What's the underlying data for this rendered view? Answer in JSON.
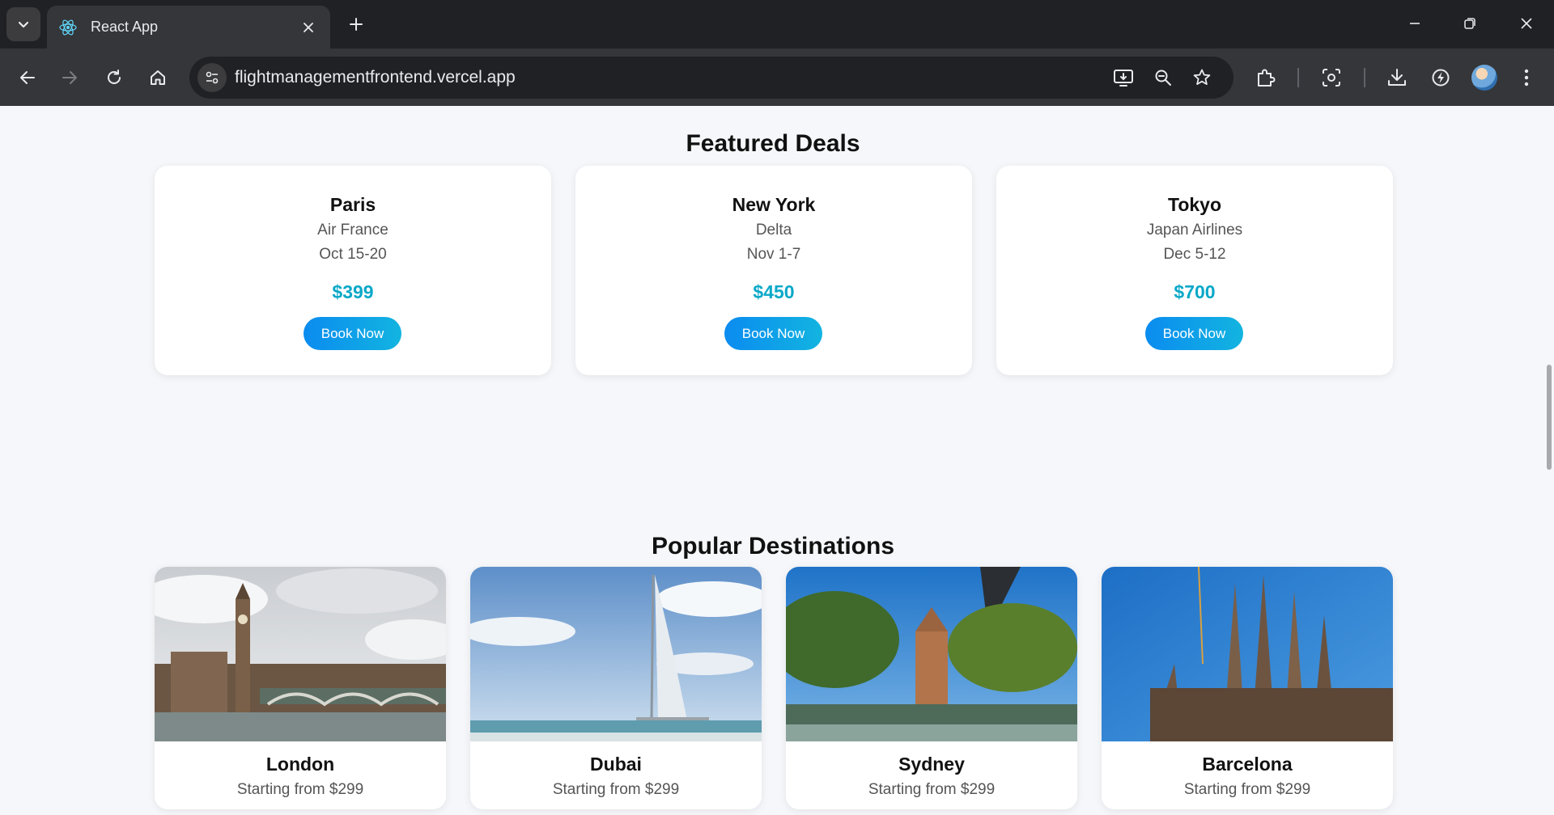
{
  "browser": {
    "tab_title": "React App",
    "url": "flightmanagementfrontend.vercel.app"
  },
  "featured": {
    "title": "Featured Deals",
    "deals": [
      {
        "city": "Paris",
        "airline": "Air France",
        "dates": "Oct 15-20",
        "price": "$399",
        "button": "Book Now"
      },
      {
        "city": "New York",
        "airline": "Delta",
        "dates": "Nov 1-7",
        "price": "$450",
        "button": "Book Now"
      },
      {
        "city": "Tokyo",
        "airline": "Japan Airlines",
        "dates": "Dec 5-12",
        "price": "$700",
        "button": "Book Now"
      }
    ]
  },
  "popular": {
    "title": "Popular Destinations",
    "destinations": [
      {
        "name": "London",
        "price": "Starting from $299"
      },
      {
        "name": "Dubai",
        "price": "Starting from $299"
      },
      {
        "name": "Sydney",
        "price": "Starting from $299"
      },
      {
        "name": "Barcelona",
        "price": "Starting from $299"
      }
    ]
  },
  "colors": {
    "price_accent": "#0aa8c8",
    "button_gradient_start": "#0b8cf0",
    "button_gradient_end": "#12b4e0",
    "page_background": "#f6f7fa"
  }
}
